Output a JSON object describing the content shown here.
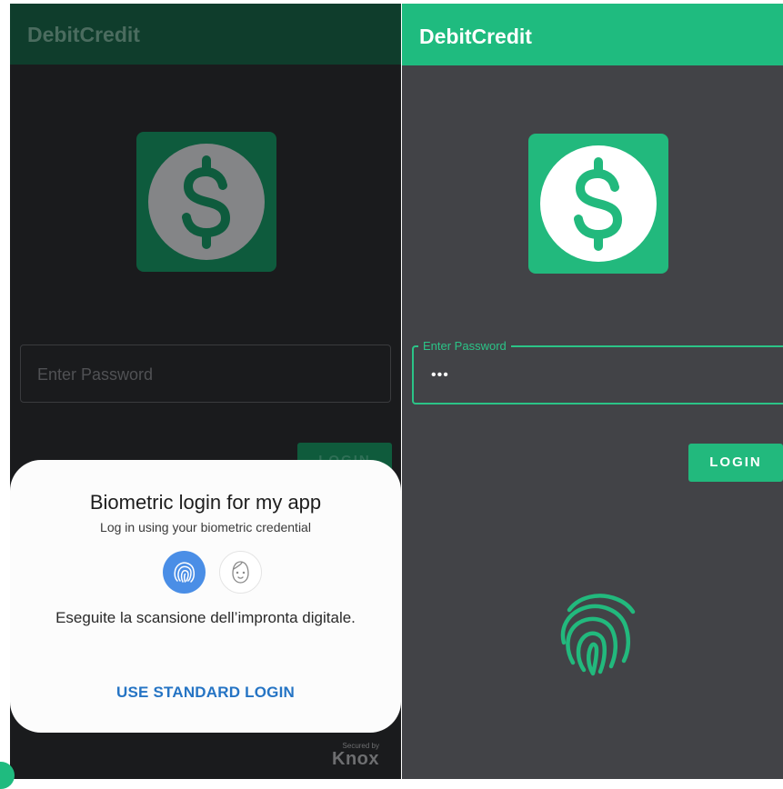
{
  "colors": {
    "brand_green": "#1fbb7f",
    "dark_green_dimmed": "#0f3d2c",
    "dialog_blue": "#2574c4",
    "fingerprint_option_bg": "#4a8ee6",
    "surface_dark": "#424347"
  },
  "left_screen": {
    "app_title": "DebitCredit",
    "logo_icon": "dollar-coin-icon",
    "password_placeholder": "Enter Password",
    "login_label": "LOGIN",
    "dialog": {
      "title": "Biometric login for my app",
      "subtitle": "Log in using your biometric credential",
      "options": [
        "fingerprint-icon",
        "face-icon"
      ],
      "scan_message": "Eseguite la scansione dell’impronta digitale.",
      "standard_login_label": "USE STANDARD LOGIN"
    },
    "knox_small": "Secured by",
    "knox_big": "Knox"
  },
  "right_screen": {
    "app_title": "DebitCredit",
    "logo_icon": "dollar-coin-icon",
    "password_label": "Enter Password",
    "password_value": "•••",
    "login_label": "LOGIN",
    "fingerprint_icon": "fingerprint-icon"
  }
}
